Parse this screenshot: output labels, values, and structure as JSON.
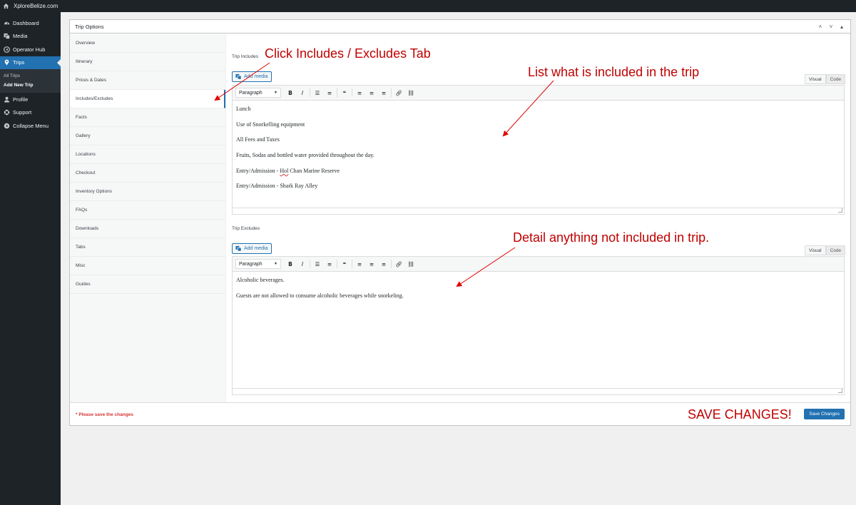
{
  "admin_bar": {
    "site_name": "XploreBelize.com",
    "home_icon": "home-icon"
  },
  "sidebar": {
    "items": [
      {
        "label": "Dashboard",
        "icon": "dashboard-icon"
      },
      {
        "label": "Media",
        "icon": "media-icon"
      },
      {
        "label": "Operator Hub",
        "icon": "hub-icon"
      },
      {
        "label": "Trips",
        "icon": "location-pin-icon",
        "current": true
      },
      {
        "label": "Profile",
        "icon": "user-icon"
      },
      {
        "label": "Support",
        "icon": "support-icon"
      },
      {
        "label": "Collapse Menu",
        "icon": "collapse-icon"
      }
    ],
    "submenu": [
      "All Trips",
      "Add New Trip"
    ]
  },
  "metabox": {
    "title": "Trip Options",
    "controls": [
      "˄",
      "˅",
      "▴"
    ]
  },
  "tabs": [
    "Overview",
    "Itinerary",
    "Prices & Dates",
    "Includes/Excludes",
    "Facts",
    "Gallery",
    "Locations",
    "Checkout",
    "Inventory Options",
    "FAQs",
    "Downloads",
    "Tabs",
    "Misc",
    "Guides"
  ],
  "active_tab": "Includes/Excludes",
  "includes": {
    "label": "Trip Includes",
    "add_media": "Add media",
    "visual": "Visual",
    "code": "Code",
    "format": "Paragraph",
    "lines": [
      "Lunch",
      "Use of Snorkelling equipment",
      "All Fees and Taxes",
      "Fruits, Sodas and bottled water provided throughout the day.",
      "Entry/Admission - ",
      "Entry/Admission - Shark Ray Alley"
    ],
    "line5_spell": "Hol",
    "line5_rest": " Chan Marine Reserve"
  },
  "excludes": {
    "label": "Trip Excludes",
    "add_media": "Add media",
    "visual": "Visual",
    "code": "Code",
    "format": "Paragraph",
    "lines": [
      "Alcoholic beverages.",
      "Guests are not allowed to consume alcoholic beverages while snorkeling."
    ]
  },
  "toolbar_icons": [
    "bold",
    "italic",
    "bullet-list",
    "numbered-list",
    "blockquote",
    "align-left",
    "align-center",
    "align-right",
    "link",
    "unlink"
  ],
  "footer": {
    "warning": "* Please save the changes",
    "save_label": "Save Changes"
  },
  "annotations": {
    "click_tab": "Click Includes / Excludes Tab",
    "list_included": "List what is included in the trip",
    "detail_excluded": "Detail anything not included in trip.",
    "save_changes": "SAVE CHANGES!",
    "color": "#c00000"
  },
  "colors": {
    "accent": "#2271b1",
    "admin_dark": "#1d2327",
    "warning": "#d63638"
  }
}
